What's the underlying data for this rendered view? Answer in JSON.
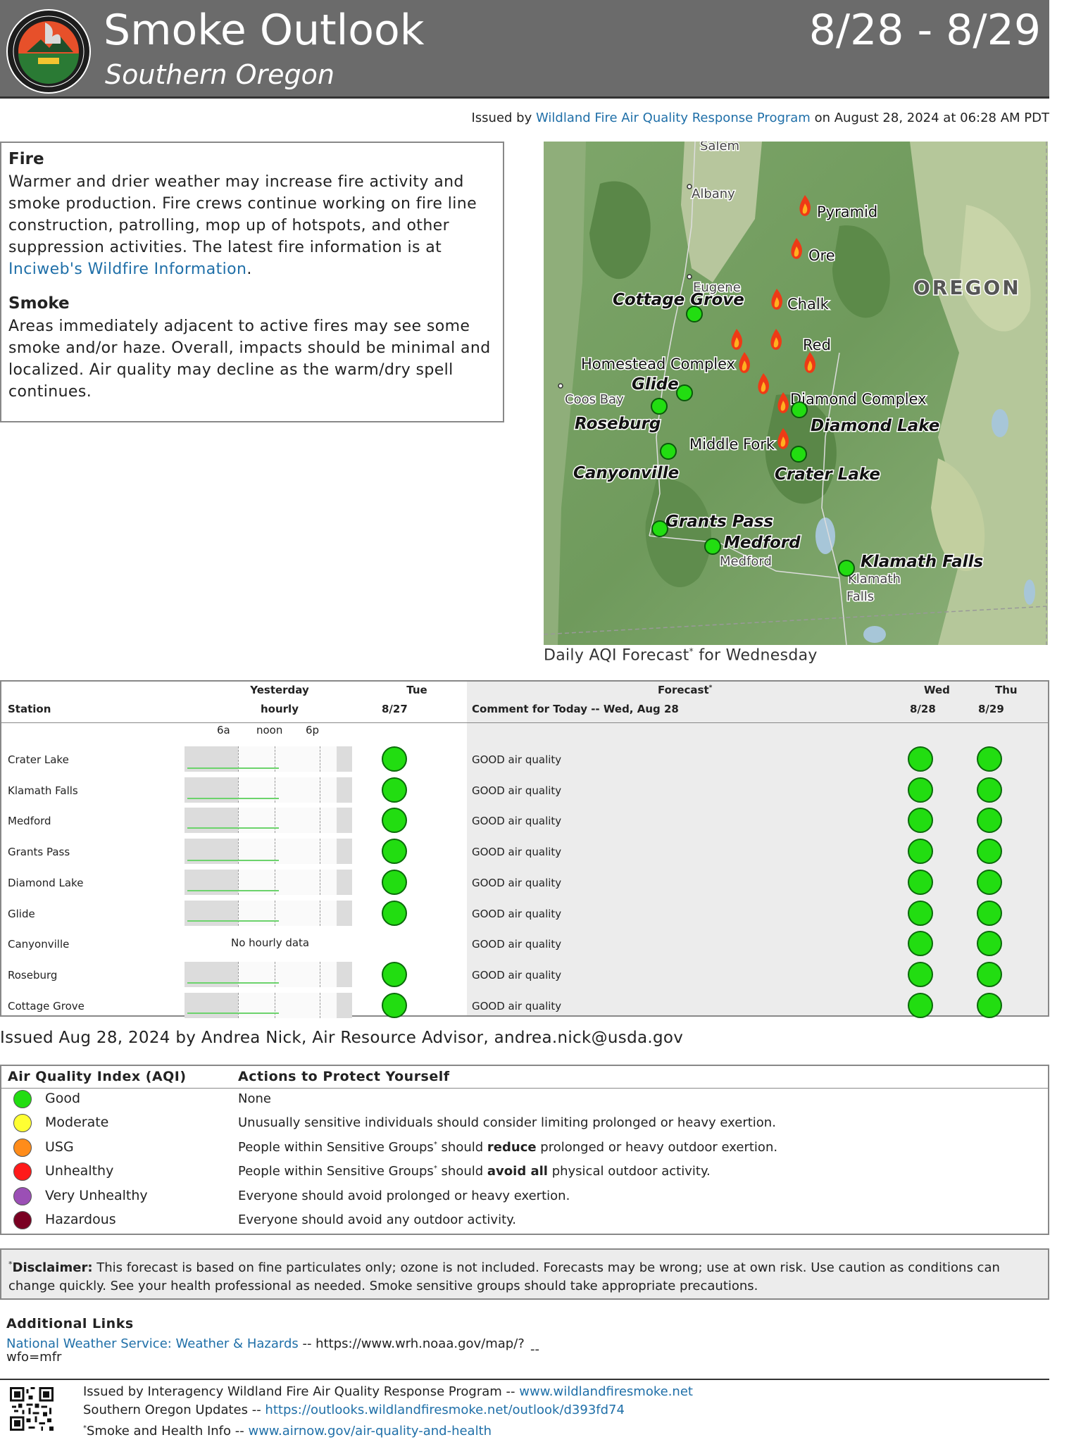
{
  "header": {
    "title": "Smoke Outlook",
    "subtitle": "Southern Oregon",
    "dates": "8/28 - 8/29",
    "logo_icon": "interagency-wildland-fire-seal-icon",
    "logo_ring_text": "INTERAGENCY WILDLAND FIRE · AIR QUALITY RESPONSE PROGRAM"
  },
  "issued": {
    "prefix": "Issued by",
    "link": "Wildland Fire Air Quality Response Program",
    "suffix": "on August 28, 2024 at 06:28 AM PDT"
  },
  "fire": {
    "heading": "Fire",
    "text": "Warmer and drier weather may increase fire activity and smoke production. Fire crews continue working on fire line construction, patrolling, mop up of hotspots, and other suppression activities. The latest fire information is at",
    "link": "Inciweb's Wildfire Information",
    "end": "."
  },
  "smoke": {
    "heading": "Smoke",
    "text": "Areas immediately adjacent to active fires may see some smoke and/or haze. Overall, impacts should be minimal and localized. Air quality may decline as the warm/dry spell continues."
  },
  "map": {
    "caption": "Daily AQI Forecast",
    "caption_sup": "*",
    "caption_end": " for Wednesday",
    "state_label": "OREGON",
    "base_labels": [
      "Salem",
      "Albany",
      "Eugene",
      "Coos Bay",
      "Medford",
      "Klamath",
      "Falls"
    ],
    "fire_labels": [
      "Pyramid",
      "Ore",
      "Chalk",
      "Red",
      "Homestead Complex",
      "Diamond Complex",
      "Middle Fork"
    ],
    "station_labels": [
      "Cottage Grove",
      "Glide",
      "Roseburg",
      "Canyonville",
      "Diamond Lake",
      "Crater Lake",
      "Grants Pass",
      "Medford",
      "Klamath Falls"
    ],
    "fire_icon": "flame-icon",
    "colors": {
      "good": "#22dd11"
    }
  },
  "stations": {
    "head": {
      "station": "Station",
      "yesterday_1": "Yesterday",
      "yesterday_2": "hourly",
      "tue_1": "Tue",
      "tue_2": "8/27",
      "forecast_1": "Forecast",
      "forecast_sup": "*",
      "comment": "Comment for Today -- Wed, Aug 28",
      "wed_1": "Wed",
      "wed_2": "8/28",
      "thu_1": "Thu",
      "thu_2": "8/29"
    },
    "hour_ticks": [
      "6a",
      "noon",
      "6p"
    ],
    "no_hourly": "No hourly data",
    "rows": [
      {
        "name": "Crater Lake",
        "hourly": true,
        "tue": "good",
        "comment": "GOOD air quality",
        "wed": "good",
        "thu": "good"
      },
      {
        "name": "Klamath Falls",
        "hourly": true,
        "tue": "good",
        "comment": "GOOD air quality",
        "wed": "good",
        "thu": "good"
      },
      {
        "name": "Medford",
        "hourly": true,
        "tue": "good",
        "comment": "GOOD air quality",
        "wed": "good",
        "thu": "good"
      },
      {
        "name": "Grants Pass",
        "hourly": true,
        "tue": "good",
        "comment": "GOOD air quality",
        "wed": "good",
        "thu": "good"
      },
      {
        "name": "Diamond Lake",
        "hourly": true,
        "tue": "good",
        "comment": "GOOD air quality",
        "wed": "good",
        "thu": "good"
      },
      {
        "name": "Glide",
        "hourly": true,
        "tue": "good",
        "comment": "GOOD air quality",
        "wed": "good",
        "thu": "good"
      },
      {
        "name": "Canyonville",
        "hourly": false,
        "tue": "",
        "comment": "GOOD air quality",
        "wed": "good",
        "thu": "good"
      },
      {
        "name": "Roseburg",
        "hourly": true,
        "tue": "good",
        "comment": "GOOD air quality",
        "wed": "good",
        "thu": "good"
      },
      {
        "name": "Cottage Grove",
        "hourly": true,
        "tue": "good",
        "comment": "GOOD air quality",
        "wed": "good",
        "thu": "good"
      }
    ]
  },
  "issued_by": "Issued Aug 28, 2024 by Andrea Nick, Air Resource Advisor, andrea.nick@usda.gov",
  "aqi": {
    "head_index": "Air Quality Index (AQI)",
    "head_actions": "Actions to Protect Yourself",
    "levels": [
      {
        "name": "Good",
        "color": "#22dd11",
        "action": "None"
      },
      {
        "name": "Moderate",
        "color": "#ffff33",
        "action": "Unusually sensitive individuals should consider limiting prolonged or heavy exertion."
      },
      {
        "name": "USG",
        "color": "#ff8c1a",
        "action_pre": "People within Sensitive Groups",
        "action_sup": "*",
        "action_mid": " should ",
        "action_bold": "reduce",
        "action_post": " prolonged or heavy outdoor exertion."
      },
      {
        "name": "Unhealthy",
        "color": "#ff1a1a",
        "action_pre": "People within Sensitive Groups",
        "action_sup": "*",
        "action_mid": " should ",
        "action_bold": "avoid all",
        "action_post": " physical outdoor activity."
      },
      {
        "name": "Very Unhealthy",
        "color": "#9b4fb5",
        "action": "Everyone should avoid prolonged or heavy exertion."
      },
      {
        "name": "Hazardous",
        "color": "#7a0022",
        "action": "Everyone should avoid any outdoor activity."
      }
    ]
  },
  "disclaimer": {
    "sup": "*",
    "label": "Disclaimer:",
    "text": " This forecast is based on fine particulates only; ozone is not included. Forecasts may be wrong; use at own risk. Use caution as conditions can change quickly. See your health professional as needed. Smoke sensitive groups should take appropriate precautions."
  },
  "links": {
    "heading": "Additional Links",
    "nws_label": "National Weather Service: Weather & Hazards",
    "nws_sep": " -- https://www.wrh.noaa.gov/map/?wfo=mfr",
    "trail": "--"
  },
  "footer": {
    "line1_text": "Issued by Interagency Wildland Fire Air Quality Response Program -- ",
    "line1_link": "www.wildlandfiresmoke.net",
    "line2_text": "Southern Oregon Updates -- ",
    "line2_link": "https://outlooks.wildlandfiresmoke.net/outlook/d393fd74",
    "line3_sup": "*",
    "line3_text": "Smoke and Health Info -- ",
    "line3_link": "www.airnow.gov/air-quality-and-health",
    "qr_icon": "qr-code-icon"
  }
}
